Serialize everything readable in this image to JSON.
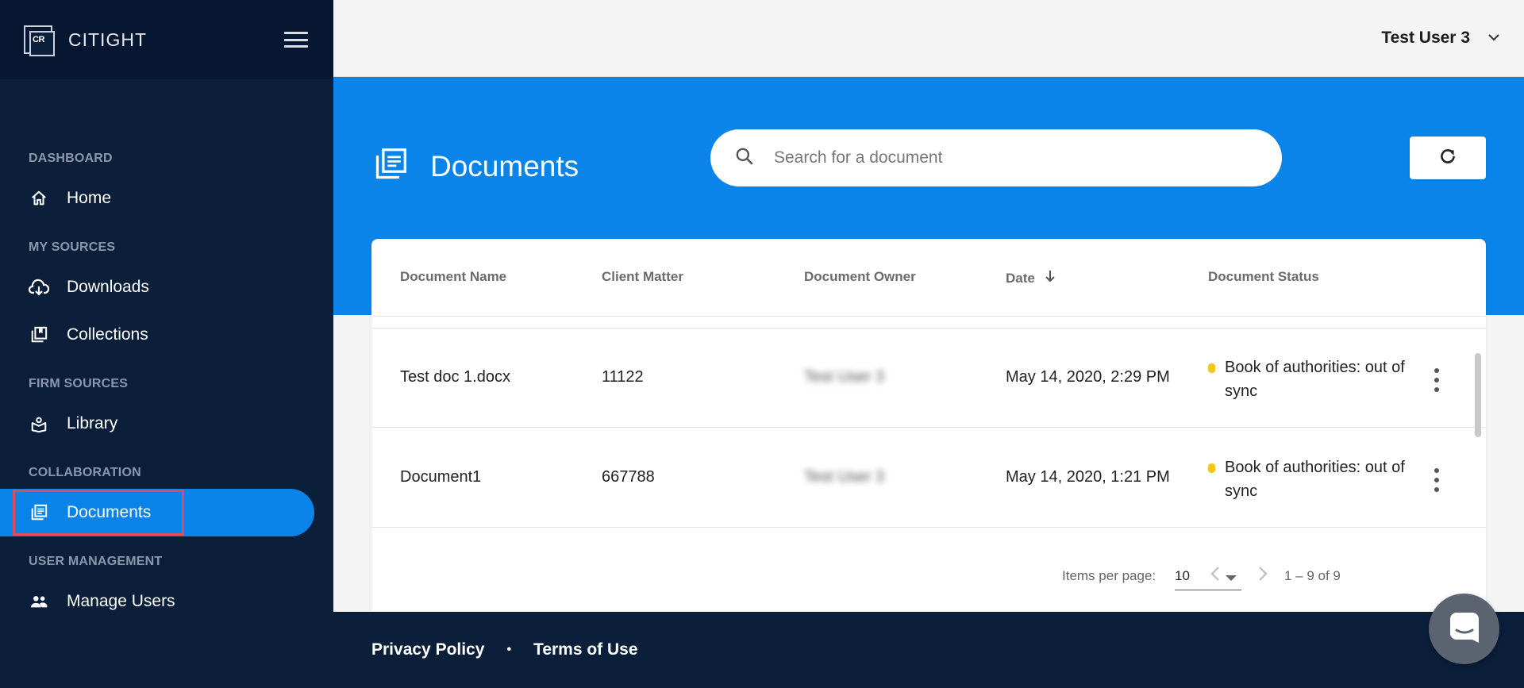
{
  "app": {
    "brand": "CITIGHT",
    "logo_text": "CR"
  },
  "sidebar": {
    "sections": [
      {
        "title": "DASHBOARD",
        "items": [
          {
            "label": "Home",
            "icon": "home-icon"
          }
        ]
      },
      {
        "title": "MY SOURCES",
        "items": [
          {
            "label": "Downloads",
            "icon": "cloud-download-icon"
          },
          {
            "label": "Collections",
            "icon": "collections-icon"
          }
        ]
      },
      {
        "title": "FIRM SOURCES",
        "items": [
          {
            "label": "Library",
            "icon": "library-icon"
          }
        ]
      },
      {
        "title": "COLLABORATION",
        "items": [
          {
            "label": "Documents",
            "icon": "documents-icon",
            "active": true
          }
        ]
      },
      {
        "title": "USER MANAGEMENT",
        "items": [
          {
            "label": "Manage Users",
            "icon": "users-icon"
          }
        ]
      }
    ]
  },
  "header": {
    "user_name": "Test User 3"
  },
  "page": {
    "title": "Documents",
    "search_placeholder": "Search for a document"
  },
  "table": {
    "headers": {
      "name": "Document Name",
      "matter": "Client Matter",
      "owner": "Document Owner",
      "date": "Date",
      "status": "Document Status"
    },
    "rows": [
      {
        "name": "Test doc 1.docx",
        "matter": "11122",
        "owner": "Test User 3",
        "date": "May 14, 2020, 2:29 PM",
        "status": "Book of authorities: out of sync"
      },
      {
        "name": "Document1",
        "matter": "667788",
        "owner": "Test User 3",
        "date": "May 14, 2020, 1:21 PM",
        "status": "Book of authorities: out of sync"
      }
    ]
  },
  "paginator": {
    "items_per_page_label": "Items per page:",
    "items_per_page_value": "10",
    "range": "1 – 9 of 9"
  },
  "footer": {
    "privacy": "Privacy Policy",
    "separator": "•",
    "terms": "Terms of Use"
  },
  "colors": {
    "sidebar": "#0b1f3a",
    "accent": "#0a84e8",
    "status_dot": "#f5c518",
    "highlight": "#e24b5b"
  }
}
